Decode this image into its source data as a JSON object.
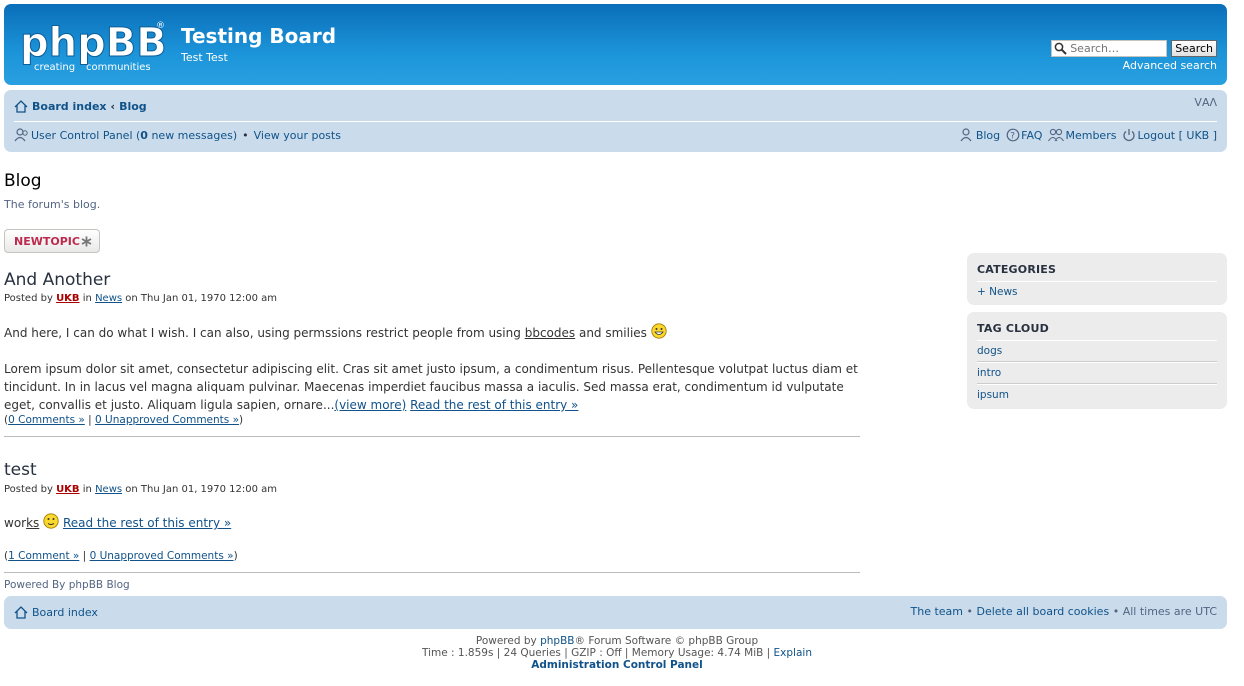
{
  "header": {
    "logo_text": "phpBB",
    "logo_tagline_1": "creating",
    "logo_tagline_2": "communities",
    "site_title": "Testing Board",
    "site_desc": "Test Test",
    "search_placeholder": "Search…",
    "search_button": "Search",
    "advanced_search": "Advanced search"
  },
  "navbar": {
    "crumbs": [
      "Board index",
      "Blog"
    ],
    "crumb_sep": "‹",
    "font_resize": "ᐯAᐱ",
    "ucp_label": "User Control Panel (",
    "ucp_count": "0",
    "ucp_suffix": " new messages)",
    "bullet": "•",
    "view_posts": "View your posts",
    "right_links": {
      "blog": "Blog",
      "faq": "FAQ",
      "members": "Members",
      "logout": "Logout [ UKB ]"
    }
  },
  "page": {
    "heading": "Blog",
    "description": "The forum's blog.",
    "newtopic_label": "NEWTOPIC"
  },
  "entries": [
    {
      "title": "And Another",
      "posted_by": "Posted by",
      "author": "UKB",
      "in": "in",
      "category": "News",
      "date": "on Thu Jan 01, 1970 12:00 am",
      "intro_pre": "And here, I can do what I wish. I can also, using permssions restrict people from using",
      "intro_link": "bbcodes",
      "intro_post": "and smilies",
      "body": "Lorem ipsum dolor sit amet, consectetur adipiscing elit. Cras sit amet justo ipsum, a condimentum risus. Pellentesque volutpat luctus diam et tincidunt. In in lacus vel magna aliquam pulvinar. Maecenas imperdiet faucibus massa a iaculis. Sed massa erat, condimentum id vulputate eget, convallis et justo. Aliquam ligula sapien, ornare...",
      "view_more": "(view more)",
      "read_more": "Read the rest of this entry »",
      "comments": "0 Comments »",
      "unapproved": "0 Unapproved Comments »"
    },
    {
      "title": "test",
      "posted_by": "Posted by",
      "author": "UKB",
      "in": "in",
      "category": "News",
      "date": "on Thu Jan 01, 1970 12:00 am",
      "body_pre": "wor",
      "body_link": "ks",
      "read_more": "Read the rest of this entry »",
      "comments": "1 Comment »",
      "unapproved": "0 Unapproved Comments »"
    }
  ],
  "powered_blog": "Powered By phpBB Blog",
  "sidebar": {
    "categories_title": "CATEGORIES",
    "categories": [
      "+ News"
    ],
    "tagcloud_title": "TAG CLOUD",
    "tags": [
      "dogs",
      "intro",
      "ipsum"
    ]
  },
  "footer": {
    "board_index": "Board index",
    "team": "The team",
    "delete_cookies": "Delete all board cookies",
    "times": "All times are UTC",
    "powered_pre": "Powered by",
    "powered_link": "phpBB",
    "powered_post": "® Forum Software © phpBB Group",
    "stats": "Time : 1.859s | 24 Queries | GZIP : Off | Memory Usage: 4.74 MiB |",
    "explain": "Explain",
    "acp": "Administration Control Panel"
  },
  "colors": {
    "header_blue": "#1c94d9",
    "nav_blue": "#cadceb",
    "link": "#105289",
    "author_red": "#aa0000",
    "newtopic_red": "#bc2a4d"
  },
  "icons": [
    "home-icon",
    "search-icon",
    "user-icon",
    "faq-icon",
    "members-icon",
    "logout-icon",
    "star-icon",
    "smiley-icon"
  ]
}
